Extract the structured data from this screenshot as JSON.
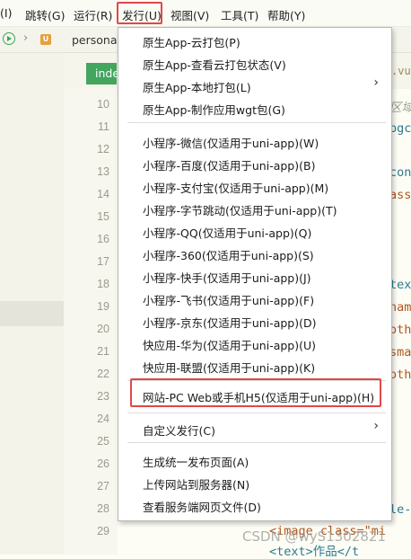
{
  "menubar": {
    "items": [
      "(I)",
      "跳转(G)",
      "运行(R)",
      "发行(U)",
      "视图(V)",
      "工具(T)",
      "帮助(Y)"
    ]
  },
  "toolbar": {
    "badge": "U",
    "path": "persona"
  },
  "tab": {
    "label": "inde"
  },
  "line_numbers": [
    "10",
    "11",
    "12",
    "13",
    "14",
    "15",
    "16",
    "17",
    "18",
    "19",
    "20",
    "21",
    "22",
    "23",
    "24",
    "25",
    "26",
    "27",
    "28",
    "29"
  ],
  "code_fragments": [
    ".vue",
    "区域",
    "bgc",
    "con",
    "ass",
    "tex",
    "nam",
    "oth",
    "sma",
    "oth",
    "le-",
    "<image class=\"mi",
    "<text>作品</t"
  ],
  "publish_menu": {
    "group1": [
      "原生App-云打包(P)",
      "原生App-查看云打包状态(V)",
      "原生App-本地打包(L)",
      "原生App-制作应用wgt包(G)"
    ],
    "group2": [
      "小程序-微信(仅适用于uni-app)(W)",
      "小程序-百度(仅适用于uni-app)(B)",
      "小程序-支付宝(仅适用于uni-app)(M)",
      "小程序-字节跳动(仅适用于uni-app)(T)",
      "小程序-QQ(仅适用于uni-app)(Q)",
      "小程序-360(仅适用于uni-app)(S)",
      "小程序-快手(仅适用于uni-app)(J)",
      "小程序-飞书(仅适用于uni-app)(F)",
      "小程序-京东(仅适用于uni-app)(D)",
      "快应用-华为(仅适用于uni-app)(U)",
      "快应用-联盟(仅适用于uni-app)(K)"
    ],
    "web": "网站-PC Web或手机H5(仅适用于uni-app)(H)",
    "custom": "自定义发行(C)",
    "group4": [
      "生成统一发布页面(A)",
      "上传网站到服务器(N)",
      "查看服务端网页文件(D)"
    ],
    "submenu_arrow": "›"
  },
  "watermark": "CSDN @wyS1302821",
  "colors": {
    "highlight_red": "#e04848",
    "tab_green": "#43a55f"
  }
}
